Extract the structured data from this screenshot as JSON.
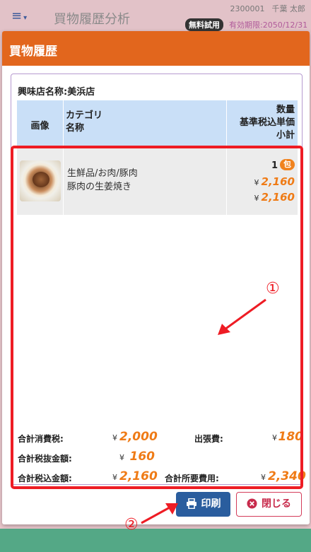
{
  "app": {
    "menu_icon": "hamburger-icon",
    "title": "買物履歴分析",
    "user_id": "2300001",
    "user_name": "千葉 太郎",
    "trial_badge": "無料試用",
    "expiry": "有効期限:2050/12/31"
  },
  "modal": {
    "title": "買物履歴",
    "shop_label": "興味店名称:美浜店",
    "table": {
      "headers": {
        "image": "画像",
        "category_line1": "カテゴリ",
        "category_line2": "名称",
        "num_line1": "数量",
        "num_line2": "基準税込単価",
        "num_line3": "小計"
      },
      "rows": [
        {
          "image_icon": "food-photo-ginger-pork",
          "category": "生鮮品/お肉/豚肉",
          "name": "豚肉の生姜焼き",
          "quantity": "1",
          "unit": "包",
          "yen1": "¥",
          "unit_price": "2,160",
          "yen2": "¥",
          "subtotal": "2,160"
        }
      ]
    },
    "summary": {
      "yen": "¥",
      "tax_label": "合計消費税:",
      "tax_value": "2,000",
      "travel_label": "出張費:",
      "travel_value": "180",
      "pretax_label": "合計税抜金額:",
      "pretax_value": "160",
      "total_label": "合計税込金額:",
      "total_value": "2,160",
      "required_label": "合計所要費用:",
      "required_value": "2,340"
    },
    "buttons": {
      "print_label": "印刷",
      "print_icon": "printer-icon",
      "close_label": "閉じる",
      "close_icon": "close-circle-icon"
    }
  },
  "annotations": {
    "callout_1": "①",
    "callout_2": "②",
    "color": "#ee1c24"
  },
  "colors": {
    "header_orange": "#e2661d",
    "price_orange": "#ef7b16",
    "table_header_blue": "#c9dff7",
    "print_button_blue": "#2a5d9e",
    "close_button_red": "#c82b4c"
  }
}
